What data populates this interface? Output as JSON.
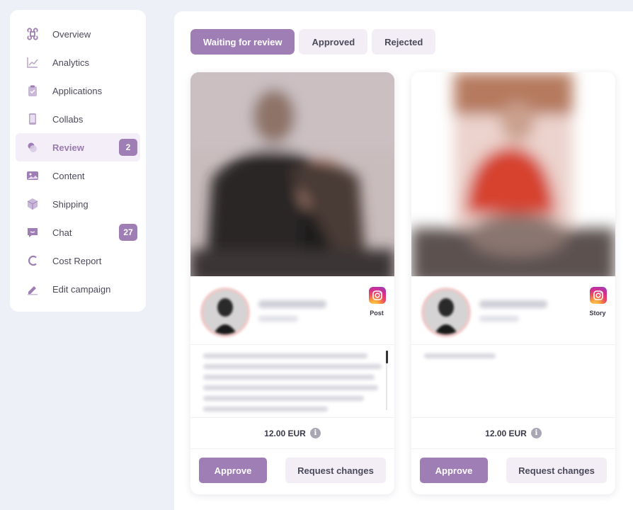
{
  "sidebar": {
    "items": [
      {
        "label": "Overview",
        "icon": "command-icon"
      },
      {
        "label": "Analytics",
        "icon": "chart-icon"
      },
      {
        "label": "Applications",
        "icon": "clipboard-icon"
      },
      {
        "label": "Collabs",
        "icon": "phone-icon"
      },
      {
        "label": "Review",
        "icon": "review-icon",
        "badge": "2",
        "active": true
      },
      {
        "label": "Content",
        "icon": "image-icon"
      },
      {
        "label": "Shipping",
        "icon": "package-icon"
      },
      {
        "label": "Chat",
        "icon": "chat-icon",
        "badge": "27"
      },
      {
        "label": "Cost Report",
        "icon": "euro-icon"
      },
      {
        "label": "Edit campaign",
        "icon": "pencil-icon"
      }
    ]
  },
  "tabs": [
    {
      "label": "Waiting for review",
      "active": true
    },
    {
      "label": "Approved"
    },
    {
      "label": "Rejected"
    }
  ],
  "cards": [
    {
      "type": "Post",
      "price": "12.00 EUR",
      "approve_label": "Approve",
      "request_label": "Request changes"
    },
    {
      "type": "Story",
      "price": "12.00 EUR",
      "approve_label": "Approve",
      "request_label": "Request changes"
    }
  ],
  "colors": {
    "accent": "#9f7eb5",
    "accent_light": "#f3eef6",
    "background": "#eef0f8",
    "text": "#3a3a4a"
  }
}
